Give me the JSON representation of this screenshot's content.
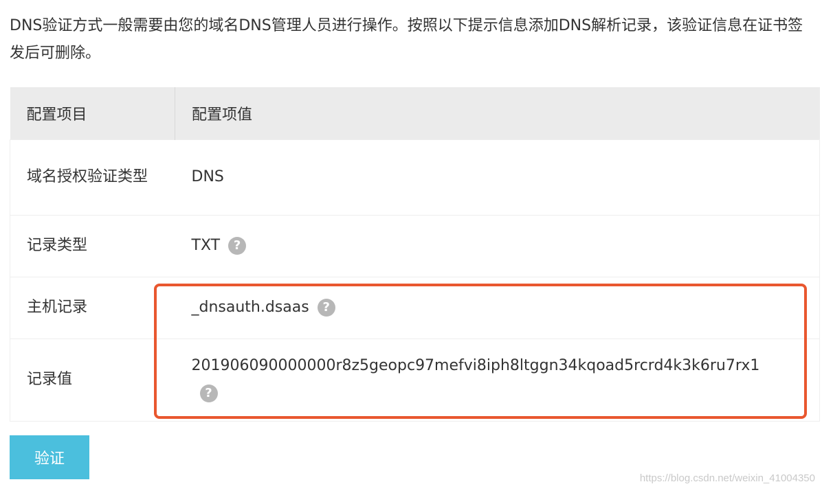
{
  "intro": "DNS验证方式一般需要由您的域名DNS管理人员进行操作。按照以下提示信息添加DNS解析记录，该验证信息在证书签发后可删除。",
  "table": {
    "headers": [
      "配置项目",
      "配置项值"
    ],
    "rows": [
      {
        "label": "域名授权验证类型",
        "value": "DNS",
        "help": false
      },
      {
        "label": "记录类型",
        "value": "TXT",
        "help": true
      },
      {
        "label": "主机记录",
        "value": "_dnsauth.dsaas",
        "help": true
      },
      {
        "label": "记录值",
        "value": "201906090000000r8z5geopc97mefvi8iph8ltggn34kqoad5rcrd4k3k6ru7rx1",
        "help": true
      }
    ]
  },
  "help_icon": {
    "glyph": "?",
    "icon": "question-circle-icon",
    "color": "#b7b7b7"
  },
  "highlight_color": "#e9572f",
  "verify_button": {
    "label": "验证",
    "color": "#4bbfdd"
  },
  "watermark": "https://blog.csdn.net/weixin_41004350"
}
